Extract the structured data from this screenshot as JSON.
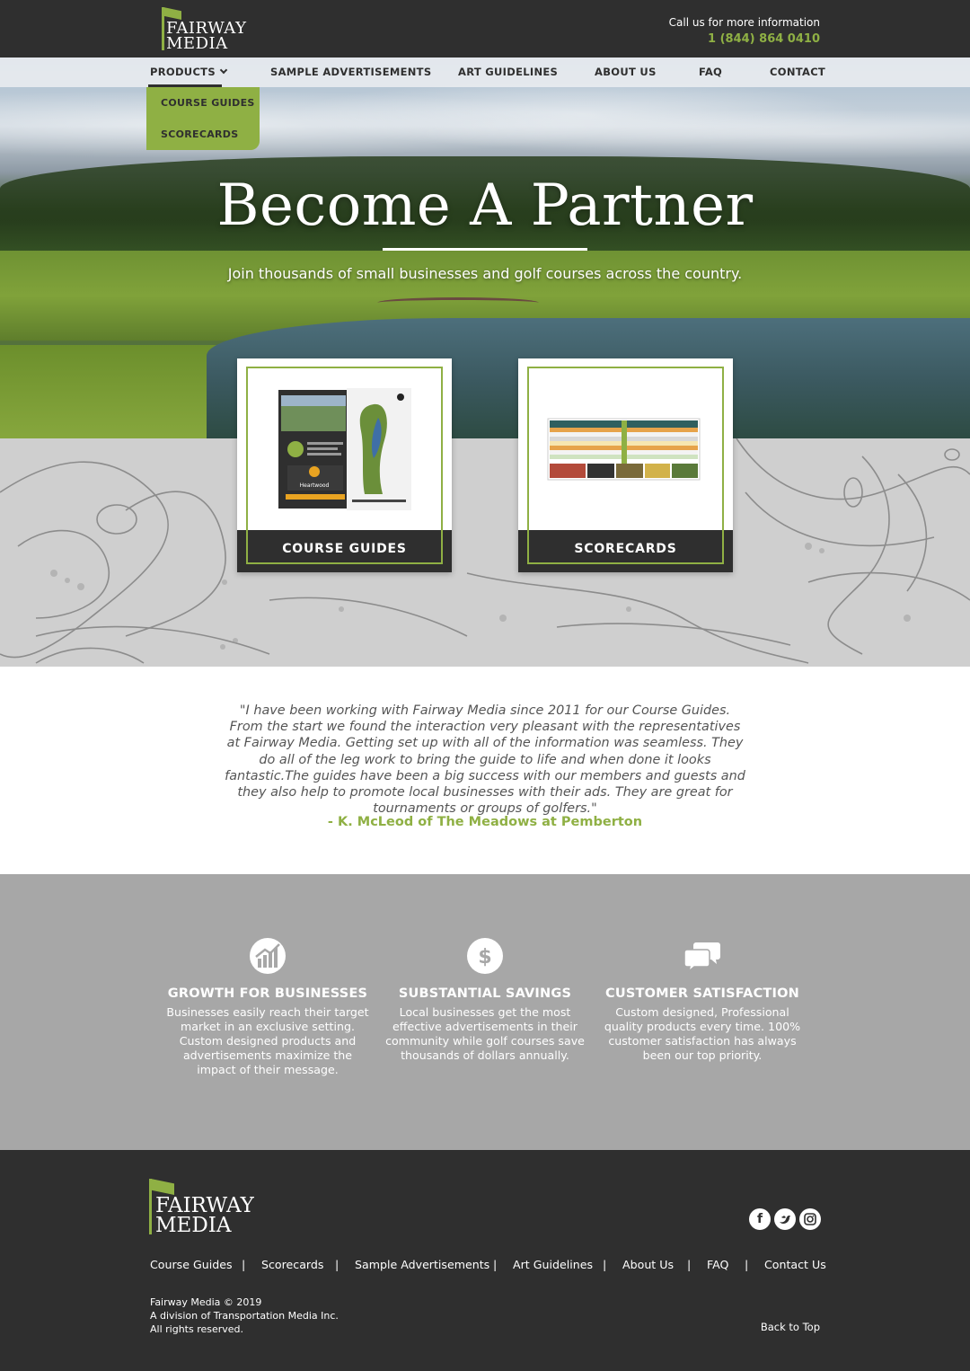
{
  "header": {
    "logo_line1": "FAIRWAY",
    "logo_line2": "MEDIA",
    "call_text": "Call us for more information",
    "phone": "1 (844) 864 0410"
  },
  "nav": {
    "items": [
      {
        "label": "PRODUCTS"
      },
      {
        "label": "SAMPLE ADVERTISEMENTS"
      },
      {
        "label": "ART GUIDELINES"
      },
      {
        "label": "ABOUT US"
      },
      {
        "label": "FAQ"
      },
      {
        "label": "CONTACT"
      }
    ],
    "dropdown": [
      {
        "label": "COURSE GUIDES"
      },
      {
        "label": "SCORECARDS"
      }
    ]
  },
  "hero": {
    "title": "Become A Partner",
    "subtitle": "Join thousands of small businesses and golf courses across the country."
  },
  "cards": [
    {
      "label": "COURSE GUIDES",
      "brochure_brand": "Heartwood"
    },
    {
      "label": "SCORECARDS"
    }
  ],
  "testimonial": {
    "quote": "\"I have been working with Fairway Media since 2011 for our Course Guides. From the start we found the interaction very pleasant with the representatives at Fairway Media. Getting set up with all of the information was seamless. They do all of the leg work to bring the guide to life and when done it looks fantastic.The guides have been a big success with our members and guests and they also help to promote local businesses with their ads. They are great for tournaments or groups of golfers.\"",
    "author": "- K. McLeod of The Meadows at Pemberton"
  },
  "features": [
    {
      "icon": "growth-chart-icon",
      "title": "GROWTH FOR BUSINESSES",
      "text": "Businesses easily reach their target market in an exclusive setting. Custom designed products and advertisements maximize the impact of their message."
    },
    {
      "icon": "dollar-icon",
      "title": "SUBSTANTIAL SAVINGS",
      "text": "Local businesses get the most effective advertisements in their community while golf courses save thousands of dollars annually."
    },
    {
      "icon": "chat-bubbles-icon",
      "title": "CUSTOMER SATISFACTION",
      "text": "Custom designed, Professional quality products every time. 100% customer satisfaction has always been our top priority."
    }
  ],
  "footer": {
    "logo_line1": "FAIRWAY",
    "logo_line2": "MEDIA",
    "social": [
      "facebook-icon",
      "twitter-icon",
      "instagram-icon"
    ],
    "links": [
      "Course Guides",
      "Scorecards",
      "Sample Advertisements",
      "Art Guidelines",
      "About Us",
      "FAQ",
      "Contact Us"
    ],
    "separator": "|",
    "copyright_1": "Fairway Media © 2019",
    "copyright_2": "A division of Transportation Media Inc.",
    "copyright_3": "All rights reserved.",
    "back_to_top": "Back to Top"
  },
  "colors": {
    "accent": "#8fb044",
    "dark": "#2f2f2f",
    "gray_band": "#a7a7a7"
  }
}
